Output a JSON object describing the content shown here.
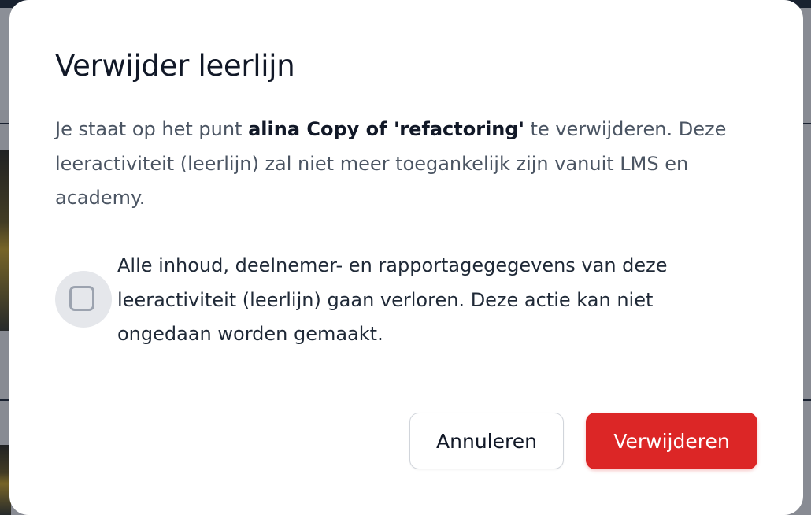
{
  "modal": {
    "title": "Verwijder leerlijn",
    "description_prefix": "Je staat op het punt ",
    "item_name": "alina Copy of 'refactoring'",
    "description_suffix": " te verwijderen. Deze leeractiviteit (leerlijn) zal niet meer toegankelijk zijn vanuit LMS en academy.",
    "confirm_text": "Alle inhoud, deelnemer- en rapportagegegevens van deze leeractiviteit (leerlijn) gaan verloren. Deze actie kan niet ongedaan worden gemaakt.",
    "confirm_checked": false,
    "cancel_label": "Annuleren",
    "delete_label": "Verwijderen"
  },
  "colors": {
    "danger": "#dc2626",
    "title": "#111827",
    "body": "#4b5563"
  }
}
